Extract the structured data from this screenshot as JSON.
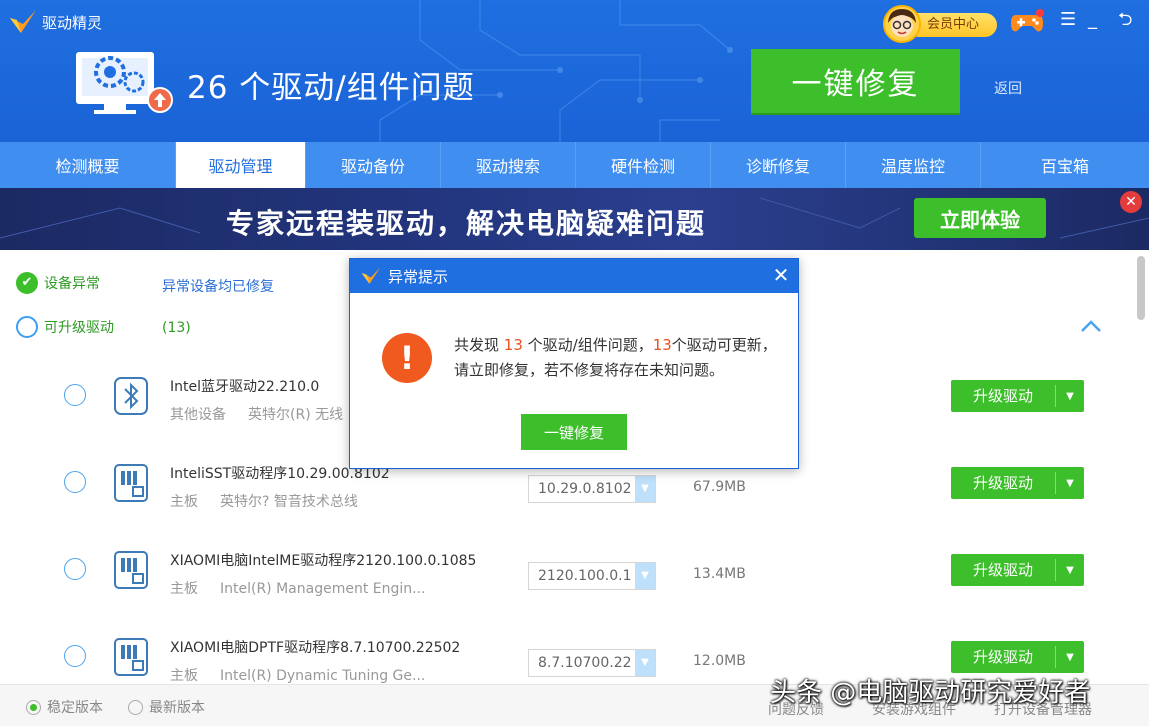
{
  "app": {
    "name": "驱动精灵"
  },
  "header": {
    "problem_count": "26",
    "problem_text": " 个驱动/组件问题",
    "fix_all_label": "一键修复",
    "back_label": "返回",
    "member_label": "会员中心"
  },
  "tabs": [
    {
      "label": "检测概要"
    },
    {
      "label": "驱动管理",
      "active": true
    },
    {
      "label": "驱动备份"
    },
    {
      "label": "驱动搜索"
    },
    {
      "label": "硬件检测"
    },
    {
      "label": "诊断修复"
    },
    {
      "label": "温度监控"
    },
    {
      "label": "百宝箱"
    }
  ],
  "banner": {
    "text": "专家远程装驱动，解决电脑疑难问题",
    "button": "立即体验"
  },
  "status": {
    "abnormal_label": "设备异常",
    "abnormal_note": "异常设备均已修复",
    "upgradable_label": "可升级驱动",
    "upgradable_count": "(13)"
  },
  "drivers": [
    {
      "name": "Intel蓝牙驱动22.210.0",
      "category": "其他设备",
      "vendor": "英特尔(R) 无线",
      "version": "",
      "size": "",
      "icon": "bluetooth-icon"
    },
    {
      "name": "InteliSST驱动程序10.29.00.8102",
      "category": "主板",
      "vendor": "英特尔? 智音技术总线",
      "version": "10.29.0.8102",
      "size": "67.9MB",
      "icon": "chip-icon"
    },
    {
      "name": "XIAOMI电脑IntelME驱动程序2120.100.0.1085",
      "category": "主板",
      "vendor": "Intel(R) Management Engin...",
      "version": "2120.100.0.1",
      "size": "13.4MB",
      "icon": "chip-icon"
    },
    {
      "name": "XIAOMI电脑DPTF驱动程序8.7.10700.22502",
      "category": "主板",
      "vendor": "Intel(R) Dynamic Tuning Ge...",
      "version": "8.7.10700.22",
      "size": "12.0MB",
      "icon": "chip-icon"
    }
  ],
  "upgrade_label": "升级驱动",
  "footer": {
    "stable": "稳定版本",
    "latest": "最新版本",
    "feedback": "问题反馈",
    "install_game": "安装游戏组件",
    "open_devmgr": "打开设备管理器"
  },
  "watermark": "头条 @电脑驱动研究爱好者",
  "dialog": {
    "title": "异常提示",
    "msg_a": "共发现 ",
    "msg_n1": "13",
    "msg_b": " 个驱动/组件问题，",
    "msg_n2": "13",
    "msg_c": "个驱动可更新，请立即修复，若不修复将存在未知问题。",
    "button": "一键修复"
  },
  "colors": {
    "brand_blue": "#1f6fe0",
    "green": "#3cbf2a",
    "highlight": "#e8521e"
  }
}
